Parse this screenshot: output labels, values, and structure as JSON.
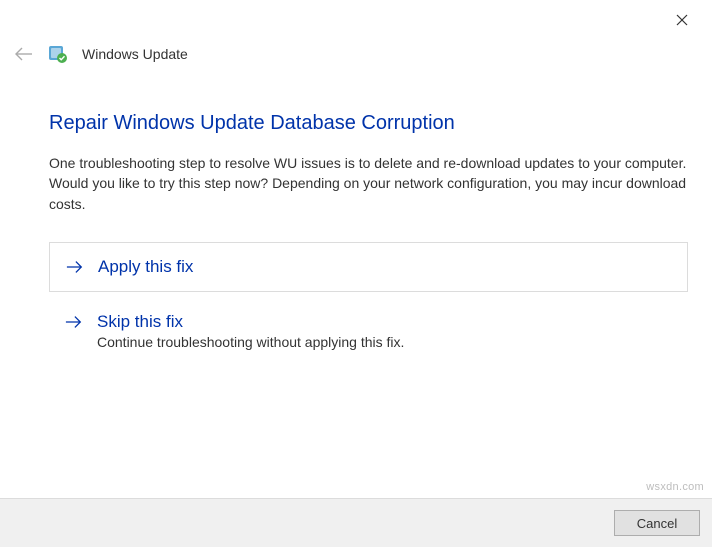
{
  "header": {
    "title": "Windows Update"
  },
  "main": {
    "heading": "Repair Windows Update Database Corruption",
    "description": "One troubleshooting step to resolve WU issues is to delete and re-download updates to your computer. Would you like to try this step now? Depending on your network configuration, you may incur download costs."
  },
  "options": {
    "apply": {
      "title": "Apply this fix"
    },
    "skip": {
      "title": "Skip this fix",
      "subtitle": "Continue troubleshooting without applying this fix."
    }
  },
  "footer": {
    "cancel": "Cancel"
  },
  "watermark": "wsxdn.com"
}
